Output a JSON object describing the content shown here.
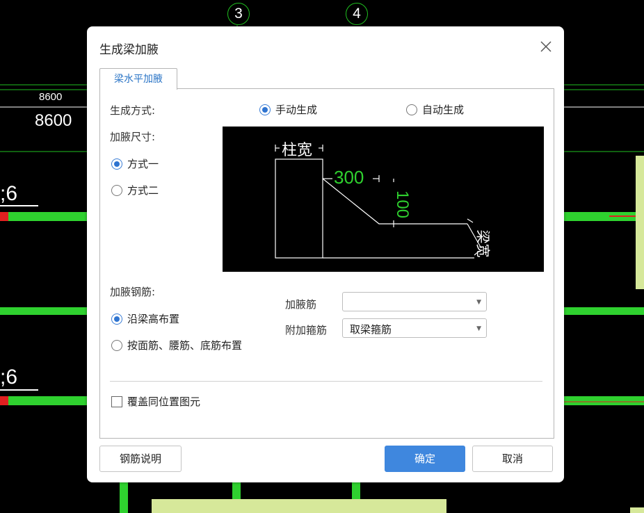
{
  "background": {
    "axis_3": "3",
    "axis_4": "4",
    "dim_small": "8600",
    "dim_large": "8600",
    "text_upper": ";6",
    "text_lower": ";6"
  },
  "dialog": {
    "title": "生成梁加腋",
    "tab_label": "梁水平加腋",
    "gen_mode_label": "生成方式:",
    "gen_manual": "手动生成",
    "gen_auto": "自动生成",
    "size_label": "加腋尺寸:",
    "size_opt1": "方式一",
    "size_opt2": "方式二",
    "preview": {
      "col_width": "柱宽",
      "dim_300": "300",
      "dim_100": "100",
      "beam_width": "梁宽"
    },
    "rebar_label": "加腋钢筋:",
    "rebar_opt1": "沿梁高布置",
    "rebar_opt2": "按面筋、腰筋、底筋布置",
    "haunch_rebar_label": "加腋筋",
    "haunch_rebar_value": "",
    "stirrup_label": "附加箍筋",
    "stirrup_value": "取梁箍筋",
    "overwrite_label": "覆盖同位置图元",
    "btn_help": "钢筋说明",
    "btn_ok": "确定",
    "btn_cancel": "取消"
  },
  "colors": {
    "accent": "#3f87de",
    "cad_green": "#2fd12f",
    "cad_red": "#e02020",
    "cad_yellow": "#d6e89a"
  }
}
